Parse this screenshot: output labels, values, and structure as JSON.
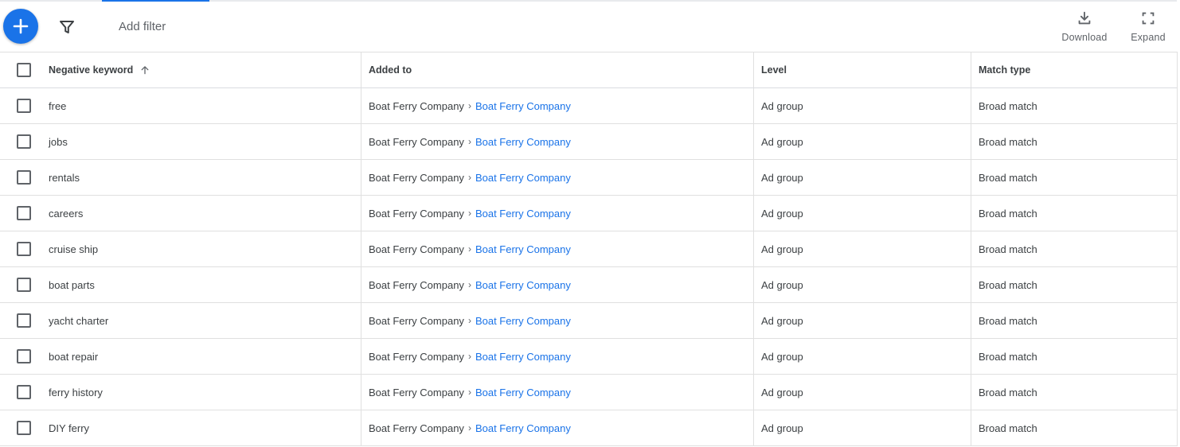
{
  "toolbar": {
    "add_filter_label": "Add filter",
    "download_label": "Download",
    "expand_label": "Expand"
  },
  "colors": {
    "accent": "#1a73e8",
    "text": "#3c4043",
    "muted": "#5f6368",
    "border": "#e0e0e0"
  },
  "icons": {
    "fab": "plus-icon",
    "filter": "filter-icon",
    "download": "download-icon",
    "expand": "expand-icon",
    "sort": "arrow-up-icon"
  },
  "table": {
    "headers": {
      "keyword": "Negative keyword",
      "added_to": "Added to",
      "level": "Level",
      "match_type": "Match type"
    },
    "rows": [
      {
        "keyword": "free",
        "campaign": "Boat Ferry Company",
        "ad_group": "Boat Ferry Company",
        "level": "Ad group",
        "match_type": "Broad match"
      },
      {
        "keyword": "jobs",
        "campaign": "Boat Ferry Company",
        "ad_group": "Boat Ferry Company",
        "level": "Ad group",
        "match_type": "Broad match"
      },
      {
        "keyword": "rentals",
        "campaign": "Boat Ferry Company",
        "ad_group": "Boat Ferry Company",
        "level": "Ad group",
        "match_type": "Broad match"
      },
      {
        "keyword": "careers",
        "campaign": "Boat Ferry Company",
        "ad_group": "Boat Ferry Company",
        "level": "Ad group",
        "match_type": "Broad match"
      },
      {
        "keyword": "cruise ship",
        "campaign": "Boat Ferry Company",
        "ad_group": "Boat Ferry Company",
        "level": "Ad group",
        "match_type": "Broad match"
      },
      {
        "keyword": "boat parts",
        "campaign": "Boat Ferry Company",
        "ad_group": "Boat Ferry Company",
        "level": "Ad group",
        "match_type": "Broad match"
      },
      {
        "keyword": "yacht charter",
        "campaign": "Boat Ferry Company",
        "ad_group": "Boat Ferry Company",
        "level": "Ad group",
        "match_type": "Broad match"
      },
      {
        "keyword": "boat repair",
        "campaign": "Boat Ferry Company",
        "ad_group": "Boat Ferry Company",
        "level": "Ad group",
        "match_type": "Broad match"
      },
      {
        "keyword": "ferry history",
        "campaign": "Boat Ferry Company",
        "ad_group": "Boat Ferry Company",
        "level": "Ad group",
        "match_type": "Broad match"
      },
      {
        "keyword": "DIY ferry",
        "campaign": "Boat Ferry Company",
        "ad_group": "Boat Ferry Company",
        "level": "Ad group",
        "match_type": "Broad match"
      }
    ]
  }
}
